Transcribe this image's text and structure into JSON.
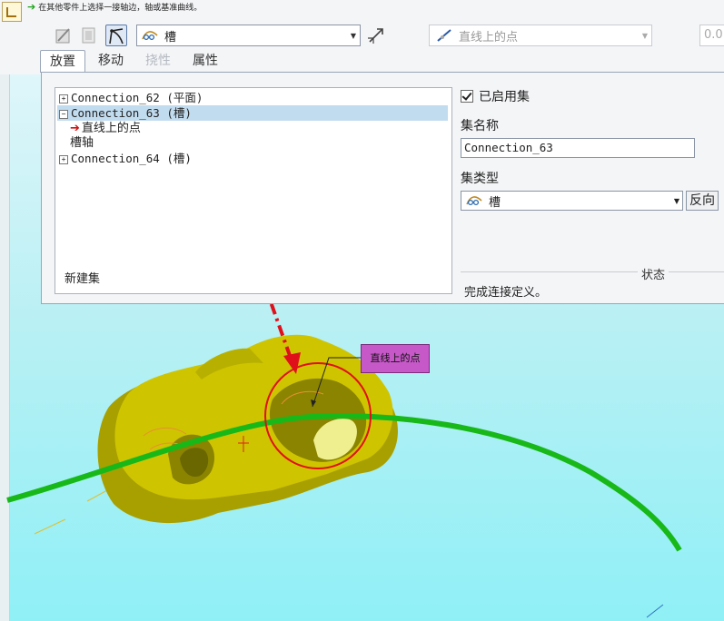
{
  "message": {
    "text": "在其他零件上选择一接轴边，轴或基准曲线。",
    "icon": "green-arrow-icon"
  },
  "toolbar": {
    "constraint_type": "槽",
    "constraint_type_icon": "slot-icon",
    "constraint_sub": "直线上的点",
    "numeric_value": "0.0"
  },
  "tabs": [
    {
      "label": "放置",
      "state": "active"
    },
    {
      "label": "移动",
      "state": "normal"
    },
    {
      "label": "挠性",
      "state": "disabled"
    },
    {
      "label": "属性",
      "state": "normal"
    }
  ],
  "tree": {
    "items": [
      {
        "label": "Connection_62 (平面)",
        "expander": "+"
      },
      {
        "label": "Connection_63 (槽)",
        "expander": "−",
        "selected": true
      },
      {
        "label": "直线上的点",
        "child": true,
        "marker": "red-arrow-icon"
      },
      {
        "label": "槽轴",
        "child": true
      },
      {
        "label": "Connection_64 (槽)",
        "expander": "+"
      }
    ],
    "new_set": "新建集"
  },
  "set_panel": {
    "enabled_label": "已启用集",
    "enabled": true,
    "name_label": "集名称",
    "name_value": "Connection_63",
    "type_label": "集类型",
    "type_value": "槽",
    "reverse_label": "反向"
  },
  "status": {
    "title": "状态",
    "text": "完成连接定义。"
  },
  "annotation": {
    "label": "直线上的点"
  },
  "colors": {
    "accent_red": "#e0101a",
    "part_yellow": "#c8c000",
    "curve_green": "#18b818",
    "callout_purple": "#c658c8",
    "viewport_cyan": "#a8f0f4"
  }
}
